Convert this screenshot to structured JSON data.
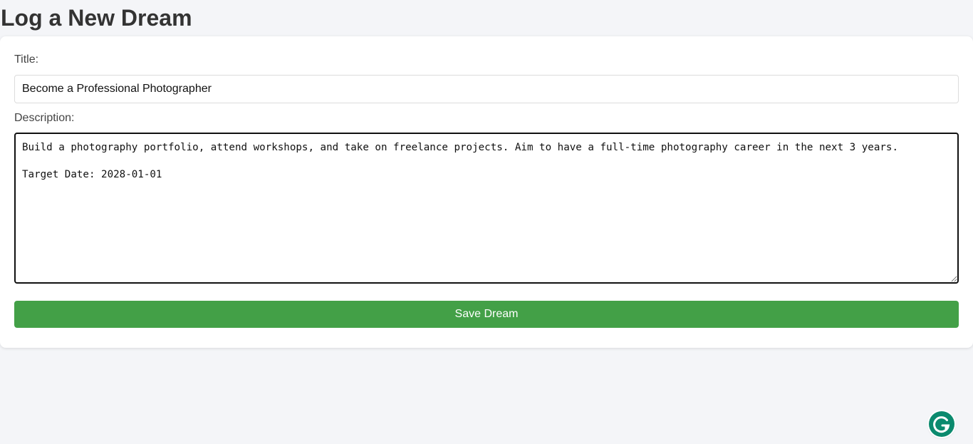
{
  "page": {
    "title": "Log a New Dream"
  },
  "form": {
    "title_label": "Title:",
    "title_value": "Become a Professional Photographer",
    "description_label": "Description:",
    "description_value": "Build a photography portfolio, attend workshops, and take on freelance projects. Aim to have a full-time photography career in the next 3 years.\n\nTarget Date: 2028-01-01",
    "save_label": "Save Dream"
  },
  "colors": {
    "accent": "#43a047",
    "background": "#f4f5f8",
    "grammarly": "#0b8a6e"
  },
  "icons": {
    "grammarly": "grammarly-icon"
  }
}
